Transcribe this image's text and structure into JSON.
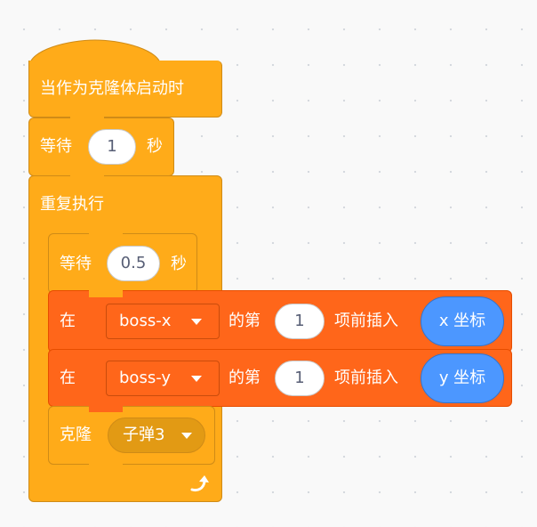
{
  "hat": {
    "label": "当作为克隆体启动时"
  },
  "wait_block": {
    "label": "等待",
    "value": "1",
    "unit": "秒"
  },
  "forever": {
    "label": "重复执行"
  },
  "wait_inner": {
    "label": "等待",
    "value": "0.5",
    "unit": "秒"
  },
  "insert_x": {
    "prefix": "在",
    "list": "boss-x",
    "middle": "的第",
    "index": "1",
    "action": "项前插入",
    "reporter": "x 坐标"
  },
  "insert_y": {
    "prefix": "在",
    "list": "boss-y",
    "middle": "的第",
    "index": "1",
    "action": "项前插入",
    "reporter": "y 坐标"
  },
  "clone": {
    "label": "克隆",
    "target": "子弹3"
  },
  "colors": {
    "control": "#ffab19",
    "control_border": "#cf8b17",
    "list": "#ff661a",
    "list_border": "#e64d00",
    "motion": "#4c97ff",
    "background": "#f9f9f9"
  },
  "icons": {
    "loop_arrow": "loop-arrow-icon",
    "dropdown": "caret-down-icon"
  }
}
